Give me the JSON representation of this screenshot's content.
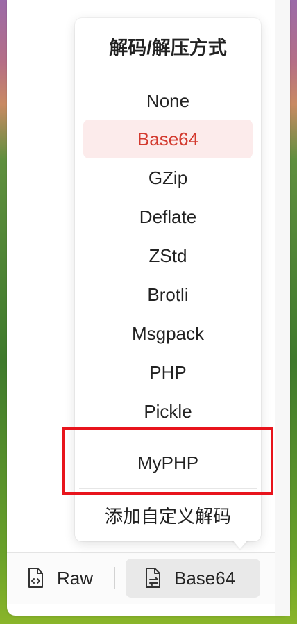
{
  "popup": {
    "title": "解码/解压方式",
    "items": [
      {
        "label": "None",
        "selected": false
      },
      {
        "label": "Base64",
        "selected": true
      },
      {
        "label": "GZip",
        "selected": false
      },
      {
        "label": "Deflate",
        "selected": false
      },
      {
        "label": "ZStd",
        "selected": false
      },
      {
        "label": "Brotli",
        "selected": false
      },
      {
        "label": "Msgpack",
        "selected": false
      },
      {
        "label": "PHP",
        "selected": false
      },
      {
        "label": "Pickle",
        "selected": false
      }
    ],
    "custom_item": "MyPHP",
    "add_custom_label": "添加自定义解码"
  },
  "bottom_bar": {
    "raw_label": "Raw",
    "raw_icon": "file-code-icon",
    "decode_label": "Base64",
    "decode_icon": "file-decode-icon"
  },
  "colors": {
    "selected_text": "#d33a2f",
    "selected_bg": "#fcebeb",
    "highlight": "#e8141c"
  }
}
